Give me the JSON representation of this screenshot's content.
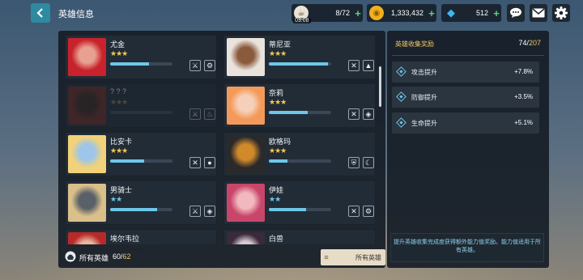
{
  "header": {
    "title": "英雄信息",
    "resources": [
      {
        "icon": "coffee-cup-icon",
        "value": "8/72",
        "timer": "03:08"
      },
      {
        "icon": "gold-coin-icon",
        "value": "1,333,432"
      },
      {
        "icon": "gem-icon",
        "value": "512"
      }
    ],
    "buttons": [
      "chat-icon",
      "mail-icon",
      "settings-icon"
    ]
  },
  "heroes": [
    {
      "name": "尤金",
      "stars": "★★★",
      "star_color": "#f2c94c",
      "progress": 0.62,
      "icons": [
        "crossed-swords-icon",
        "gear-icon"
      ],
      "locked": false,
      "portrait": [
        "#c8232c",
        "#e8a090"
      ]
    },
    {
      "name": "蒂尼亚",
      "stars": "★★★",
      "star_color": "#f2c94c",
      "progress": 0.95,
      "icons": [
        "crossed-axes-icon",
        "mountain-icon"
      ],
      "locked": false,
      "portrait": [
        "#e9e3dc",
        "#8a5a3c"
      ]
    },
    {
      "name": "? ? ?",
      "stars": "★★★",
      "star_color": "#8a7a44",
      "progress": 0,
      "icons": [
        "crossed-swords-icon",
        "flame-icon"
      ],
      "locked": true,
      "portrait": [
        "#6a2a22",
        "#3a241c"
      ]
    },
    {
      "name": "奈莉",
      "stars": "★★★",
      "star_color": "#f2c94c",
      "progress": 0.62,
      "icons": [
        "crossed-axes-icon",
        "diamond-icon"
      ],
      "locked": false,
      "portrait": [
        "#f39a5a",
        "#f6d0b8"
      ]
    },
    {
      "name": "比安卡",
      "stars": "★★★",
      "star_color": "#f2c94c",
      "progress": 0.55,
      "icons": [
        "crossed-axes-icon",
        "droplet-icon"
      ],
      "locked": false,
      "portrait": [
        "#f1d27a",
        "#9ec6e8"
      ]
    },
    {
      "name": "欧格玛",
      "stars": "★★★",
      "star_color": "#f2c94c",
      "progress": 0.3,
      "icons": [
        "shield-icon",
        "moon-icon"
      ],
      "locked": false,
      "portrait": [
        "#2a2a2a",
        "#d08a2a"
      ]
    },
    {
      "name": "男骑士",
      "stars": "★★",
      "star_color": "#6ec7ea",
      "progress": 0.75,
      "icons": [
        "crossed-swords-icon",
        "diamond-icon"
      ],
      "locked": false,
      "portrait": [
        "#d9c08a",
        "#5a6068"
      ]
    },
    {
      "name": "伊娃",
      "stars": "★★",
      "star_color": "#6ec7ea",
      "progress": 0.6,
      "icons": [
        "crossed-axes-icon",
        "gear-icon"
      ],
      "locked": false,
      "portrait": [
        "#c8466a",
        "#f2b8c0"
      ]
    },
    {
      "name": "埃尔韦拉",
      "stars": "",
      "star_color": "#f2c94c",
      "progress": 0,
      "icons": [],
      "locked": false,
      "portrait": [
        "#b82a2a",
        "#e8b8a0"
      ]
    },
    {
      "name": "白兽",
      "stars": "",
      "star_color": "#f2c94c",
      "progress": 0,
      "icons": [],
      "locked": false,
      "portrait": [
        "#3a2a3a",
        "#d8c8d0"
      ]
    }
  ],
  "footer": {
    "label": "所有英雄",
    "count_owned": "60",
    "count_sep": "/",
    "count_total": "62",
    "filter_label": "所有英雄"
  },
  "collection": {
    "title": "英雄收集奖励",
    "current": "74",
    "sep": "/",
    "total": "207",
    "bonuses": [
      {
        "label": "攻击提升",
        "value": "+7.8%"
      },
      {
        "label": "防御提升",
        "value": "+3.5%"
      },
      {
        "label": "生命提升",
        "value": "+5.1%"
      }
    ],
    "note": "提升英雄收集完成度获得额外能力值奖励。能力值适用于所有英雄。"
  }
}
